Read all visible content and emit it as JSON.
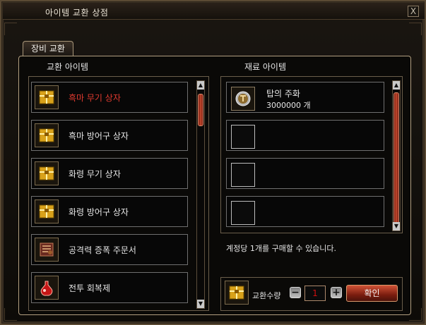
{
  "window": {
    "title": "아이템 교환 상점",
    "close_label": "X"
  },
  "tabs": [
    {
      "label": "장비 교환",
      "selected": true
    }
  ],
  "left": {
    "header": "교환 아이템",
    "items": [
      {
        "label": "흑마 무기 상자",
        "icon": "gold-box-icon",
        "selected": true
      },
      {
        "label": "흑마 방어구 상자",
        "icon": "gold-box-icon",
        "selected": false
      },
      {
        "label": "화령 무기 상자",
        "icon": "gold-box-icon",
        "selected": false
      },
      {
        "label": "화령 방어구 상자",
        "icon": "gold-box-icon",
        "selected": false
      },
      {
        "label": "공격력 증폭 주문서",
        "icon": "scroll-icon",
        "selected": false
      },
      {
        "label": "전투 회복제",
        "icon": "potion-icon",
        "selected": false
      }
    ]
  },
  "right": {
    "header": "재료 아이템",
    "materials": [
      {
        "name": "탑의 주화",
        "quantity": "3000000 개",
        "icon": "tower-coin-icon",
        "filled": true
      },
      {
        "name": "",
        "quantity": "",
        "icon": "",
        "filled": false
      },
      {
        "name": "",
        "quantity": "",
        "icon": "",
        "filled": false
      },
      {
        "name": "",
        "quantity": "",
        "icon": "",
        "filled": false
      }
    ],
    "notice": "계정당 1개를 구매할 수 있습니다."
  },
  "exchange": {
    "label": "교환수량",
    "quantity": "1",
    "confirm_label": "확인",
    "icon": "gold-box-icon"
  },
  "colors": {
    "selected_text": "#e03a2f",
    "confirm_button": "#7b1d0f",
    "border": "#b29f80",
    "quantity_text": "#d10f0f"
  }
}
